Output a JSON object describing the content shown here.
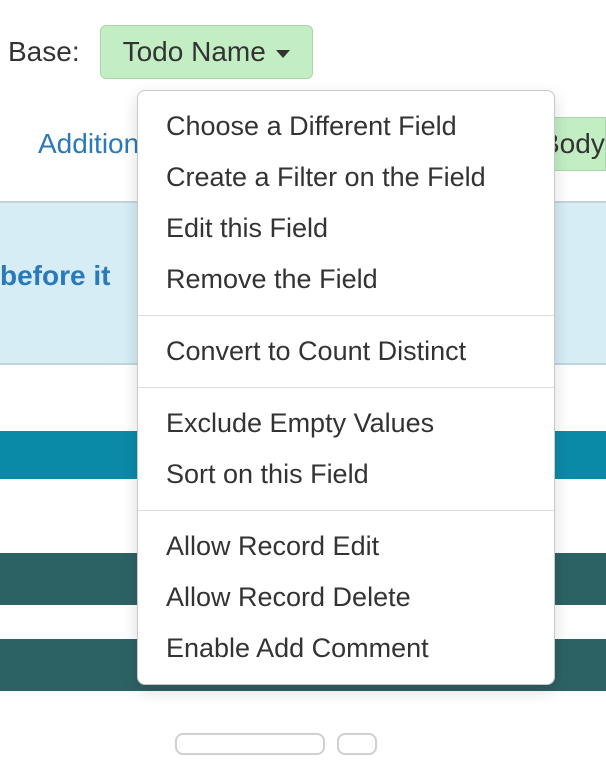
{
  "base": {
    "label": "Base:",
    "field_button": "Todo Name"
  },
  "additional_link": "Addition",
  "body_chip": "Body",
  "before_it_text": "before it",
  "menu": {
    "groups": [
      {
        "items": [
          {
            "label": "Choose a Different Field"
          },
          {
            "label": "Create a Filter on the Field"
          },
          {
            "label": "Edit this Field"
          },
          {
            "label": "Remove the Field"
          }
        ]
      },
      {
        "items": [
          {
            "label": "Convert to Count Distinct"
          }
        ]
      },
      {
        "items": [
          {
            "label": "Exclude Empty Values"
          },
          {
            "label": "Sort on this Field"
          }
        ]
      },
      {
        "items": [
          {
            "label": "Allow Record Edit"
          },
          {
            "label": "Allow Record Delete"
          },
          {
            "label": "Enable Add Comment"
          }
        ]
      }
    ]
  }
}
